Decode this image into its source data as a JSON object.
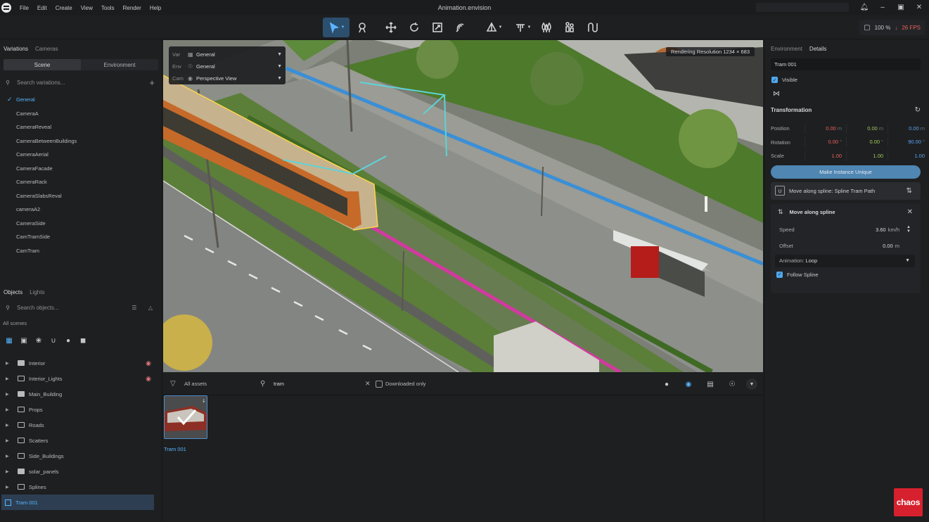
{
  "window": {
    "title": "Animation.envision"
  },
  "menu": [
    "File",
    "Edit",
    "Create",
    "View",
    "Tools",
    "Render",
    "Help"
  ],
  "toolbar": {
    "zoom": "100 %",
    "fps": "26 FPS",
    "fps_arrow": "↓",
    "active_tool": "select"
  },
  "left_panel": {
    "tabs": [
      "Variations",
      "Cameras"
    ],
    "segments": [
      "Scene",
      "Environment"
    ],
    "search_placeholder": "Search variations...",
    "variations": [
      {
        "label": "General",
        "selected": true
      },
      {
        "label": "CameraA"
      },
      {
        "label": "CameraReveal"
      },
      {
        "label": "CameraBetweenBuildings"
      },
      {
        "label": "CameraAerial"
      },
      {
        "label": "CameraFacade"
      },
      {
        "label": "CameraRack"
      },
      {
        "label": "CameraSlabsReval"
      },
      {
        "label": "cameraA2"
      },
      {
        "label": "CameraSide"
      },
      {
        "label": "CamTramSide"
      },
      {
        "label": "CamTram"
      }
    ],
    "objects_tabs": [
      "Objects",
      "Lights"
    ],
    "objects_search_placeholder": "Search objects...",
    "scope": "All scenes",
    "tree": [
      {
        "label": "Interior",
        "hidden": true,
        "filled": true
      },
      {
        "label": "Interior_Lights",
        "hidden": true
      },
      {
        "label": "Main_Building",
        "filled": true
      },
      {
        "label": "Props"
      },
      {
        "label": "Roads"
      },
      {
        "label": "Scatters"
      },
      {
        "label": "Side_Buildings"
      },
      {
        "label": "solar_panels",
        "filled": true
      },
      {
        "label": "Splines"
      },
      {
        "label": "Tram 001",
        "selected": true
      }
    ]
  },
  "viewport": {
    "overlay": [
      {
        "key": "Var",
        "value": "General"
      },
      {
        "key": "Env",
        "value": "General"
      },
      {
        "key": "Cam",
        "value": "Perspective View"
      }
    ],
    "rendering_resolution": "Rendering Resolution   1234 × 683"
  },
  "assets": {
    "filter_label": "All assets",
    "query": "tram",
    "downloaded_only_label": "Downloaded only",
    "items": [
      {
        "label": "Tram 001"
      }
    ]
  },
  "right_panel": {
    "tabs": [
      "Environment",
      "Details"
    ],
    "object_name": "Tram 001",
    "visible_label": "Visible",
    "transformation_title": "Transformation",
    "rows": [
      {
        "label": "Position",
        "x": "0.00",
        "y": "0.00",
        "z": "0.00",
        "unit": "m"
      },
      {
        "label": "Rotation",
        "x": "0.00",
        "y": "0.00",
        "z": "90.00",
        "unit": "°"
      },
      {
        "label": "Scale",
        "x": "1.00",
        "y": "1.00",
        "z": "1.00",
        "unit": ""
      }
    ],
    "make_unique_label": "Make Instance Unique",
    "component_label": "Move along spline: Spline Tram Path",
    "spline_card": {
      "title": "Move along spline",
      "speed_label": "Speed",
      "speed_value": "3.60",
      "speed_unit": "km/h",
      "offset_label": "Offset",
      "offset_value": "0.00",
      "offset_unit": "m",
      "animation_label": "Animation:",
      "animation_value": "Loop",
      "follow_label": "Follow Spline"
    }
  },
  "brand": "chaos",
  "colors": {
    "accent": "#58b6ff",
    "x_axis": "#e8615a",
    "y_axis": "#9fcb5a",
    "z_axis": "#58a7f0",
    "brand": "#d6202e"
  }
}
